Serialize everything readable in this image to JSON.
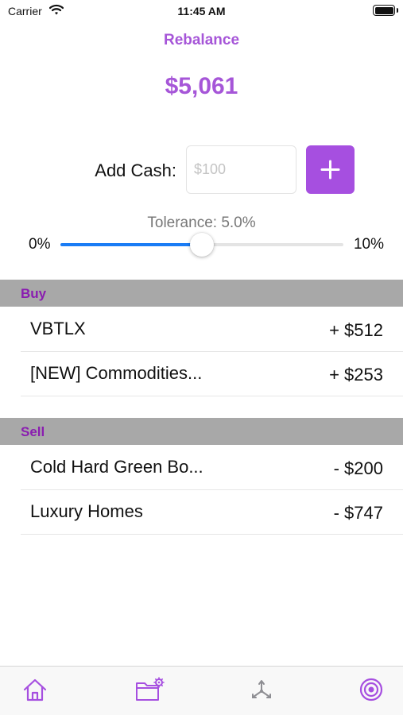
{
  "status_bar": {
    "carrier": "Carrier",
    "time": "11:45 AM"
  },
  "header": {
    "title": "Rebalance",
    "total": "$5,061"
  },
  "add_cash": {
    "label": "Add Cash:",
    "placeholder": "$100",
    "button_icon": "plus-icon"
  },
  "tolerance": {
    "label": "Tolerance: 5.0%",
    "min_label": "0%",
    "max_label": "10%",
    "value_fraction": 0.5
  },
  "sections": {
    "buy": {
      "title": "Buy",
      "rows": [
        {
          "name": "VBTLX",
          "amount": "+ $512"
        },
        {
          "name": "[NEW] Commodities...",
          "amount": "+ $253"
        }
      ]
    },
    "sell": {
      "title": "Sell",
      "rows": [
        {
          "name": "Cold Hard Green Bo...",
          "amount": "- $200"
        },
        {
          "name": "Luxury Homes",
          "amount": "- $747"
        }
      ]
    }
  },
  "tab_bar": {
    "tabs": [
      {
        "icon": "home-icon",
        "selected": false
      },
      {
        "icon": "folder-settings-icon",
        "selected": false
      },
      {
        "icon": "rebalance-tripod-icon",
        "selected": false
      },
      {
        "icon": "target-icon",
        "selected": true
      }
    ]
  },
  "colors": {
    "accent": "#a656d8",
    "button": "#a64fe0",
    "section_title": "#8a1db0",
    "section_bg": "#a8a8a8",
    "slider_fill": "#1a7cf5",
    "tab_icon_active": "#a64fe0",
    "tab_icon_inactive": "#8e8e93"
  }
}
